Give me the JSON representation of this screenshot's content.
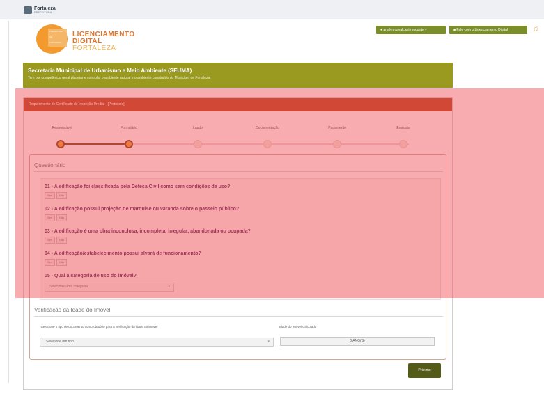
{
  "top": {
    "logo_title": "Fortaleza",
    "logo_sub": "PREFEITURA"
  },
  "brand": {
    "badge_text": [
      "PREFEITURA",
      "DE",
      "FORTALEZA"
    ],
    "line1": "LICENCIAMENTO",
    "line2": "DIGITAL",
    "line3": "FORTALEZA"
  },
  "header": {
    "user_button": "analyn cavalcante mourão",
    "contact_button": "Fale com o Licenciamento Digital"
  },
  "secretaria": {
    "title": "Secretaria Municipal de Urbanismo e Meio Ambiente (SEUMA)",
    "subtitle": "Tem por competência geral planejar e controlar o ambiente natural e o ambiente construído do Município de Fortaleza."
  },
  "panel": {
    "title": "Requerimento de Certificado de Inspeção Predial - [Protocolo]"
  },
  "steps": [
    {
      "label": "Responsável",
      "state": "done"
    },
    {
      "label": "Formulário",
      "state": "current"
    },
    {
      "label": "Laudo",
      "state": "pending"
    },
    {
      "label": "Documentação",
      "state": "pending"
    },
    {
      "label": "Pagamento",
      "state": "pending"
    },
    {
      "label": "Emissão",
      "state": "pending"
    }
  ],
  "questionario": {
    "title": "Questionário",
    "questions": [
      "01 - A edificação foi classificada pela Defesa Civil como sem condições de uso?",
      "02 - A edificação possui projeção de marquise ou varanda sobre o passeio público?",
      "03 - A edificação é uma obra inconclusa, incompleta, irregular, abandonada ou ocupada?",
      "04 - A edificação/estabelecimento possui alvará de funcionamento?",
      "05 - Qual a categoria de uso do imóvel?"
    ],
    "options": [
      "Sim",
      "Não"
    ],
    "category_placeholder": "Selecione uma categoria"
  },
  "verificacao": {
    "title": "Verificação da Idade do Imóvel",
    "doc_label": "*Selecione o tipo de documento comprobatório para a verificação da idade do imóvel",
    "age_label": "Idade do Imóvel Calculada",
    "doc_placeholder": "Selecione um tipo",
    "age_value": "0 ANO(S)"
  },
  "actions": {
    "next": "Próximo"
  },
  "colors": {
    "accent": "#7a8f2a",
    "panel_header": "#b84a22",
    "overlay": "#f04650",
    "step": "#f0a030"
  }
}
